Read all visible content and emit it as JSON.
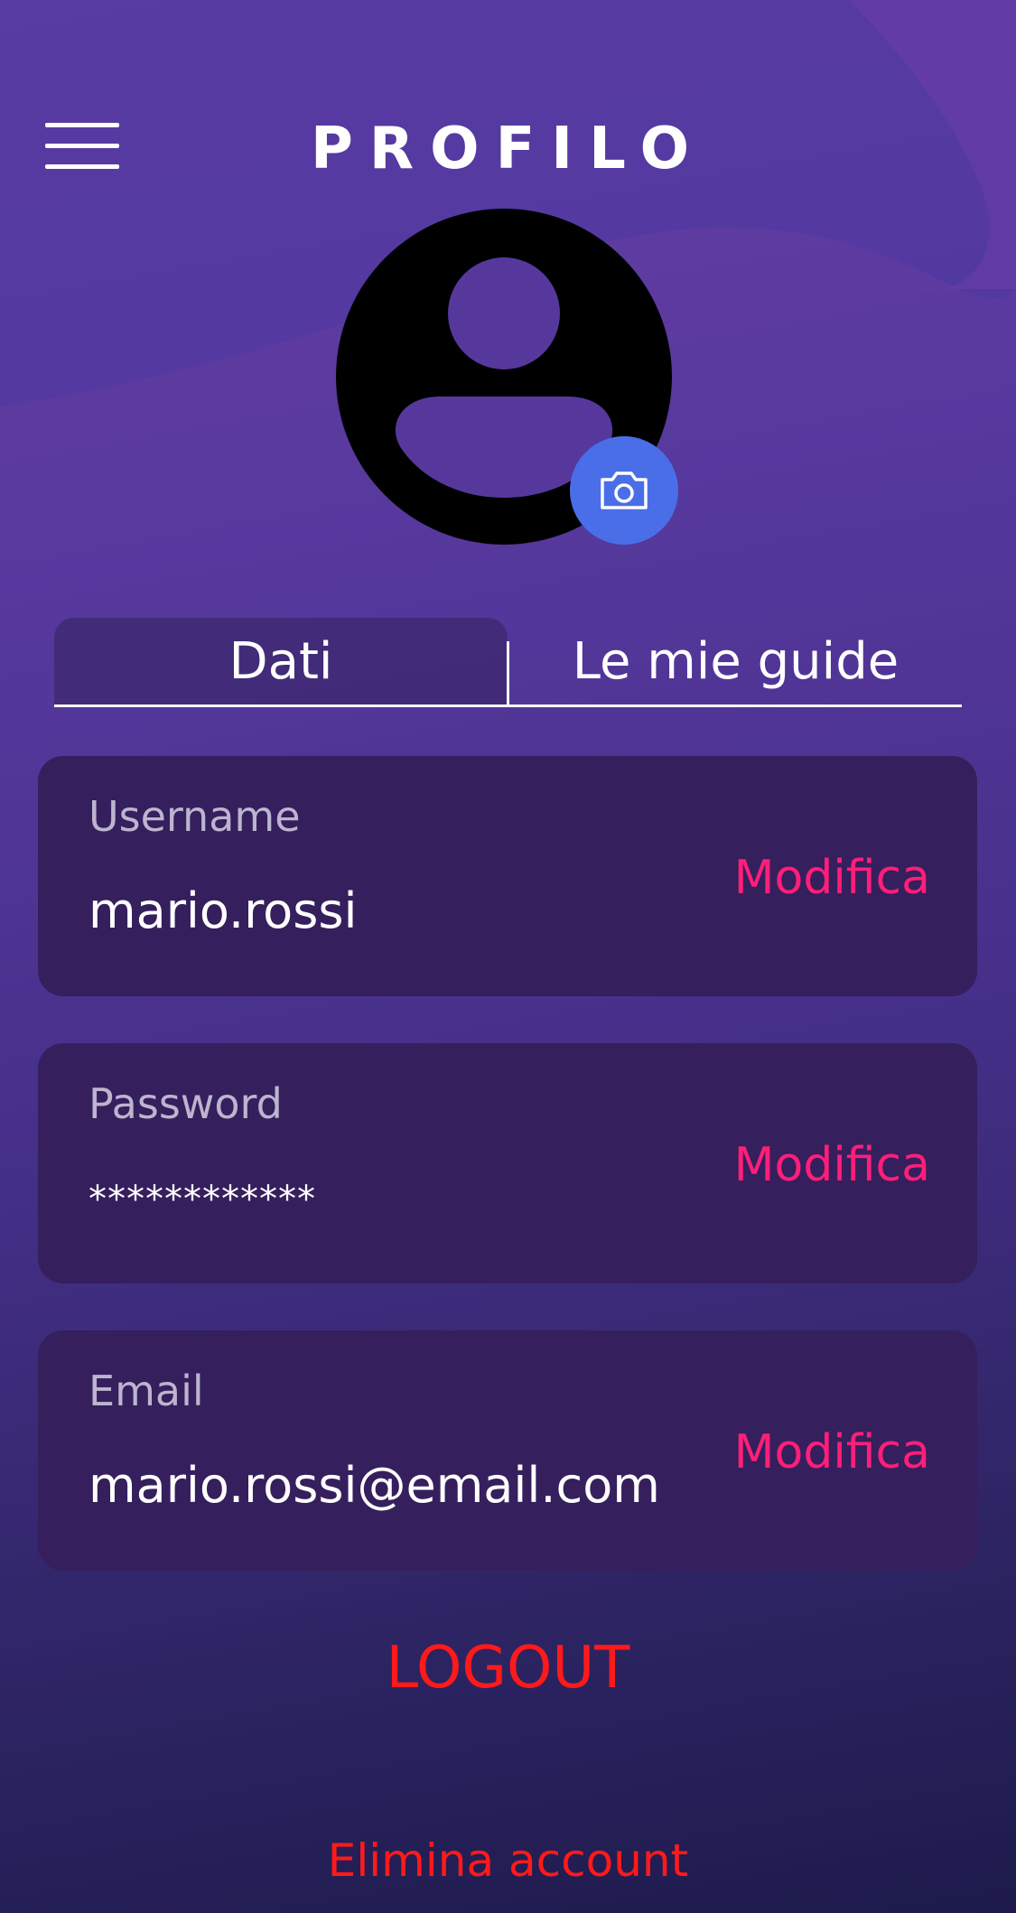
{
  "header": {
    "title": "PROFILO",
    "menu_icon": "hamburger-menu-icon"
  },
  "avatar": {
    "icon": "user-avatar-icon",
    "camera_icon": "camera-icon"
  },
  "tabs": [
    {
      "label": "Dati",
      "active": true
    },
    {
      "label": "Le mie guide",
      "active": false
    }
  ],
  "fields": [
    {
      "label": "Username",
      "value": "mario.rossi",
      "action": "Modifica"
    },
    {
      "label": "Password",
      "value": "************",
      "action": "Modifica"
    },
    {
      "label": "Email",
      "value": "mario.rossi@email.com",
      "action": "Modifica"
    }
  ],
  "logout_label": "LOGOUT",
  "delete_account_label": "Elimina account",
  "colors": {
    "accent_pink": "#ff1e78",
    "danger_red": "#ff1a1a",
    "camera_blue": "#4a6ee8",
    "card_bg": "#351f5d"
  }
}
